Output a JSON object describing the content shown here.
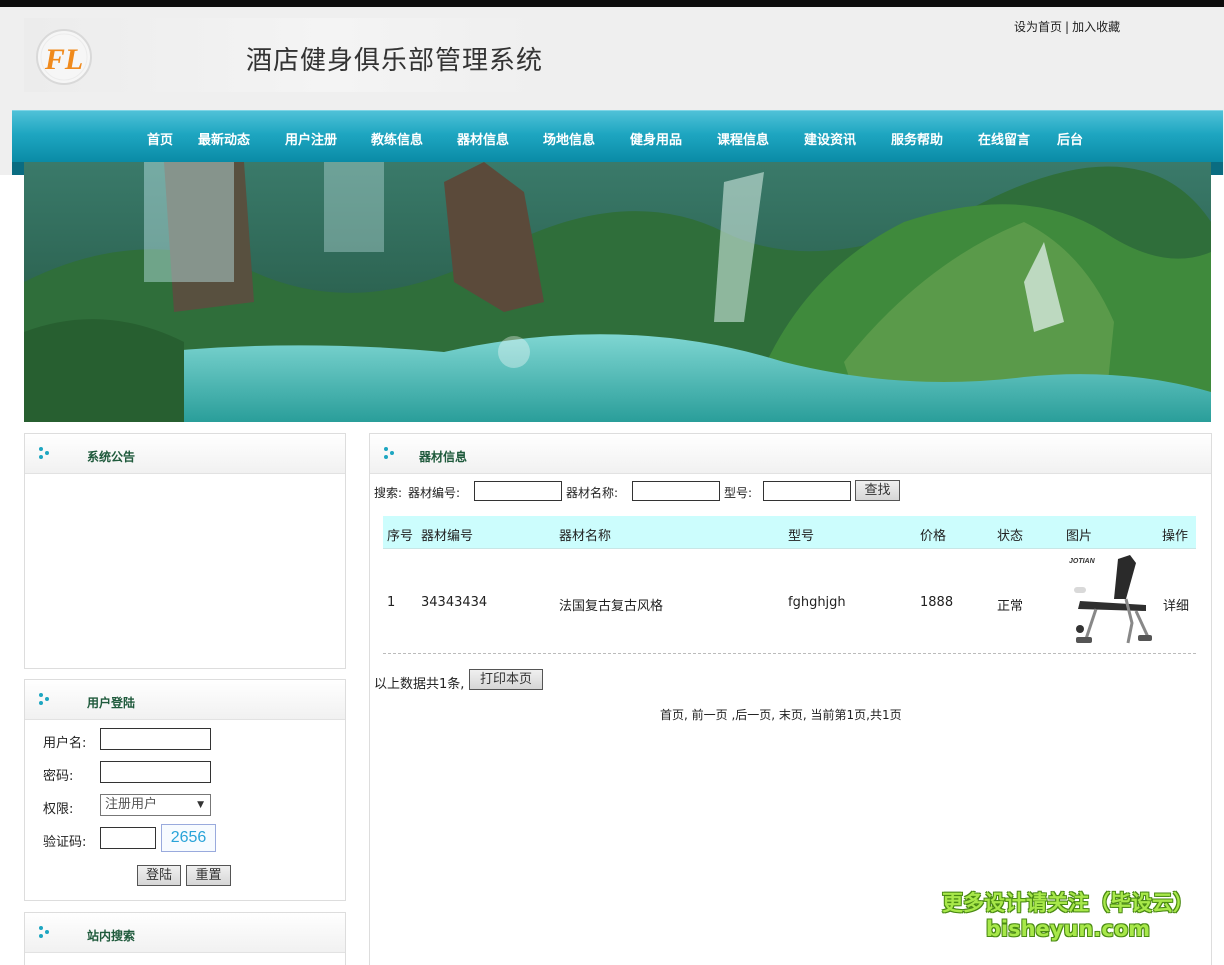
{
  "header": {
    "site_title": "酒店健身俱乐部管理系统",
    "logo_text": "FL",
    "top_links": {
      "set_home": "设为首页",
      "separator": "|",
      "favorite": "加入收藏"
    }
  },
  "nav": {
    "items": [
      "首页",
      "最新动态",
      "用户注册",
      "教练信息",
      "器材信息",
      "场地信息",
      "健身用品",
      "课程信息",
      "建设资讯",
      "服务帮助",
      "在线留言",
      "后台"
    ]
  },
  "sidebar": {
    "notice": {
      "title": "系统公告"
    },
    "login": {
      "title": "用户登陆",
      "username_label": "用户名:",
      "password_label": "密码:",
      "role_label": "权限:",
      "role_selected": "注册用户",
      "captcha_label": "验证码:",
      "captcha_code": "2656",
      "login_button": "登陆",
      "reset_button": "重置"
    },
    "site_search": {
      "title": "站内搜索"
    }
  },
  "main": {
    "title": "器材信息",
    "search": {
      "prefix": "搜索:",
      "code_label": "器材编号:",
      "name_label": "器材名称:",
      "model_label": "型号:",
      "button": "查找"
    },
    "table": {
      "headers": [
        "序号",
        "器材编号",
        "器材名称",
        "型号",
        "价格",
        "状态",
        "图片",
        "操作"
      ],
      "rows": [
        {
          "index": "1",
          "code": "34343434",
          "name": "法国复古复古风格",
          "model": "fghghjgh",
          "price": "1888",
          "status": "正常",
          "image_brand": "JOTIAN",
          "action": "详细"
        }
      ]
    },
    "summary": "以上数据共1条,",
    "print_button": "打印本页",
    "pagination": "首页, 前一页 ,后一页, 末页, 当前第1页,共1页"
  },
  "watermark": {
    "line1": "更多设计请关注（毕设云）",
    "line2": "bisheyun.com"
  },
  "colors": {
    "nav": "#1ea6c1",
    "table_header": "#ccfdfd",
    "panel_title": "#1f5a3c",
    "captcha": "#29a3d8"
  },
  "icons": {
    "panel_bullet": "bullet-dots-icon",
    "select_arrow": "triangle-down-icon"
  }
}
